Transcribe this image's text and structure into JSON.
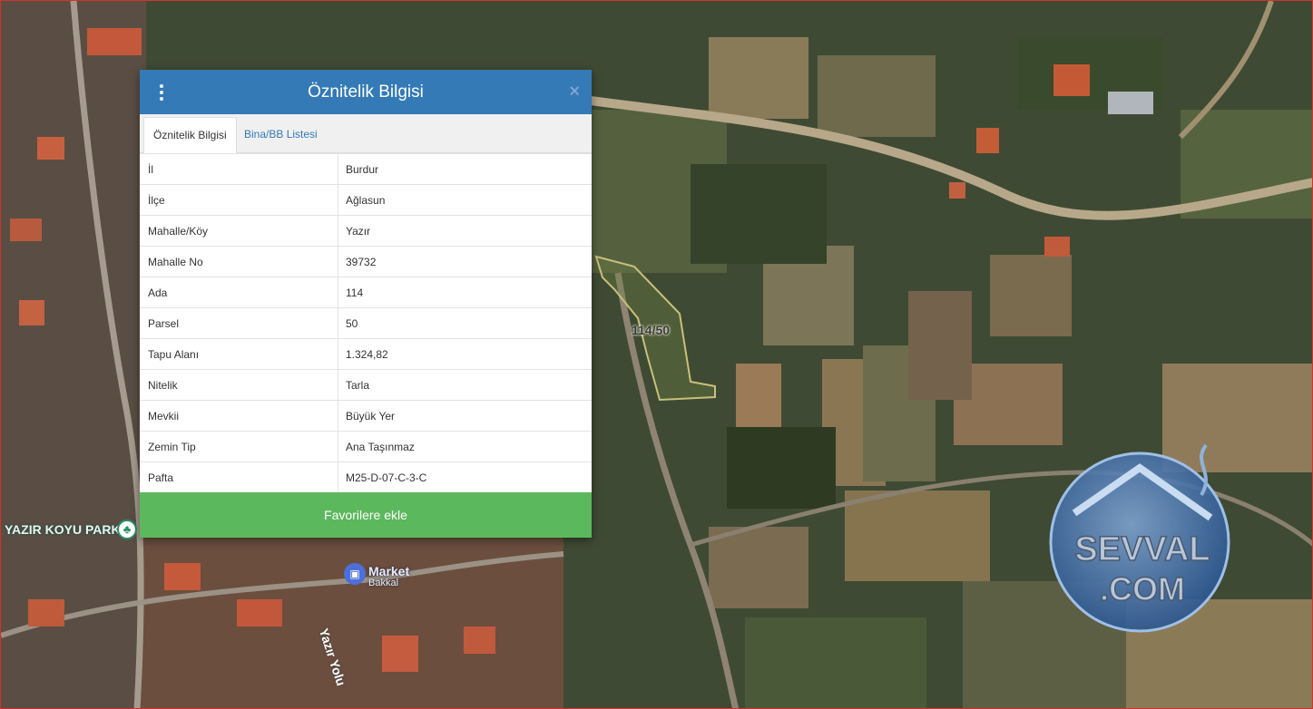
{
  "map": {
    "park_label": "YAZIR KOYU PARKI",
    "market_label": "Market",
    "market_sublabel": "Bakkal",
    "road_label": "Yazır Yolu",
    "parcel_label": "114/50"
  },
  "panel": {
    "title": "Öznitelik Bilgisi",
    "close_symbol": "×",
    "tabs": [
      {
        "label": "Öznitelik Bilgisi",
        "active": true
      },
      {
        "label": "Bina/BB Listesi",
        "active": false
      }
    ],
    "rows": [
      {
        "key": "İl",
        "value": "Burdur"
      },
      {
        "key": "İlçe",
        "value": "Ağlasun"
      },
      {
        "key": "Mahalle/Köy",
        "value": "Yazır"
      },
      {
        "key": "Mahalle No",
        "value": "39732"
      },
      {
        "key": "Ada",
        "value": "114"
      },
      {
        "key": "Parsel",
        "value": "50"
      },
      {
        "key": "Tapu Alanı",
        "value": "1.324,82"
      },
      {
        "key": "Nitelik",
        "value": "Tarla"
      },
      {
        "key": "Mevkii",
        "value": "Büyük Yer"
      },
      {
        "key": "Zemin Tip",
        "value": "Ana Taşınmaz"
      },
      {
        "key": "Pafta",
        "value": "M25-D-07-C-3-C"
      }
    ],
    "favorite_button": "Favorilere ekle"
  },
  "watermark": {
    "line1": "SEVVAL",
    "line2": ".COM"
  },
  "colors": {
    "header_blue": "#337ab7",
    "button_green": "#5cb85c",
    "parcel_outline": "#c9c07a"
  }
}
